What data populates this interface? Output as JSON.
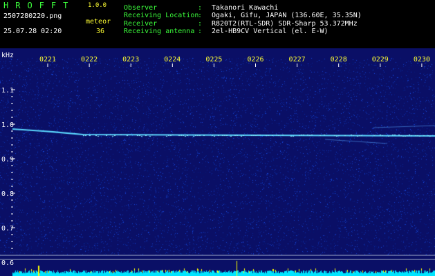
{
  "header": {
    "app_name": "HROFFT",
    "version": "1.0.0",
    "filename": "2507280220.png",
    "datetime": "25.07.28 02:20",
    "meteor_label": "meteor",
    "meteor_count": "36"
  },
  "info": [
    {
      "label": "Observer",
      "value": "Takanori Kawachi"
    },
    {
      "label": "Receiving Location",
      "value": "Ogaki, Gifu, JAPAN (136.60E, 35.35N)"
    },
    {
      "label": "Receiver",
      "value": "R820T2(RTL-SDR) SDR-Sharp 53.372MHz"
    },
    {
      "label": "Receiving antenna",
      "value": "2el-HB9CV Vertical (el. E-W)"
    }
  ],
  "info_separator": ":",
  "plot": {
    "unit_label": "kHz",
    "time_ticks": [
      "0221",
      "0222",
      "0223",
      "0224",
      "0225",
      "0226",
      "0227",
      "0228",
      "0229",
      "0230"
    ],
    "freq_ticks": [
      "1.1",
      "1.0",
      "0.9",
      "0.8",
      "0.7",
      "0.6"
    ],
    "colors": {
      "background": "#0a0f66",
      "carrier": "#5bd8ff",
      "level_bars": "#00e5ff",
      "level_spikes": "#ffff00",
      "time_labels": "#ffff33",
      "header_labels": "#3cff3c"
    }
  }
}
